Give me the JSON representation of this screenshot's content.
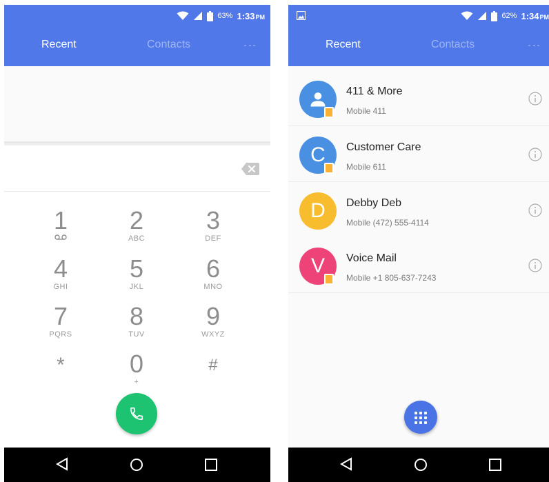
{
  "colors": {
    "header": "#5178e8",
    "call": "#1ec371",
    "fab": "#4a73e6",
    "tab_inactive": "#9eb5f4"
  },
  "left_screen": {
    "status": {
      "battery": "63%",
      "time": "1:33",
      "ampm": "PM"
    },
    "tabs": {
      "recent": "Recent",
      "contacts": "Contacts"
    },
    "keys": [
      {
        "digit": "1",
        "letters": ""
      },
      {
        "digit": "2",
        "letters": "ABC"
      },
      {
        "digit": "3",
        "letters": "DEF"
      },
      {
        "digit": "4",
        "letters": "GHI"
      },
      {
        "digit": "5",
        "letters": "JKL"
      },
      {
        "digit": "6",
        "letters": "MNO"
      },
      {
        "digit": "7",
        "letters": "PQRS"
      },
      {
        "digit": "8",
        "letters": "TUV"
      },
      {
        "digit": "9",
        "letters": "WXYZ"
      },
      {
        "digit": "*",
        "letters": ""
      },
      {
        "digit": "0",
        "letters": "+"
      },
      {
        "digit": "#",
        "letters": ""
      }
    ]
  },
  "right_screen": {
    "status": {
      "battery": "62%",
      "time": "1:34",
      "ampm": "PM"
    },
    "tabs": {
      "recent": "Recent",
      "contacts": "Contacts"
    },
    "contacts": [
      {
        "name": "411 & More",
        "detail": "Mobile 411",
        "initial": "",
        "color": "#4a90e2"
      },
      {
        "name": "Customer Care",
        "detail": "Mobile 611",
        "initial": "C",
        "color": "#4a90e2"
      },
      {
        "name": "Debby Deb",
        "detail": "Mobile (472) 555-4114",
        "initial": "D",
        "color": "#f8bd2f"
      },
      {
        "name": "Voice Mail",
        "detail": "Mobile +1 805-637-7243",
        "initial": "V",
        "color": "#ee4379"
      }
    ]
  }
}
